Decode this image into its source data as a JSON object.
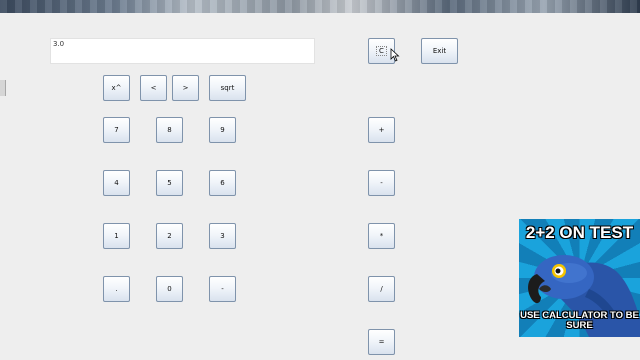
{
  "display": {
    "value": "3.0"
  },
  "buttons": {
    "clear": "C",
    "exit": "Exit",
    "power": "x^",
    "left": "<",
    "right": ">",
    "sqrt": "sqrt",
    "seven": "7",
    "eight": "8",
    "nine": "9",
    "four": "4",
    "five": "5",
    "six": "6",
    "one": "1",
    "two": "2",
    "three": "3",
    "decimal": ".",
    "zero": "0",
    "negate": "-",
    "plus": "+",
    "minus": "-",
    "multiply": "*",
    "divide": "/",
    "equals": "="
  },
  "meme": {
    "top_text": "2+2 ON TEST",
    "bottom_text": "USE CALCULATOR TO BE SURE",
    "colors": {
      "background": "#1a9fd9",
      "parrot": "#2f5fb8"
    }
  },
  "icons": {
    "pointer": "mouse-pointer-icon"
  }
}
